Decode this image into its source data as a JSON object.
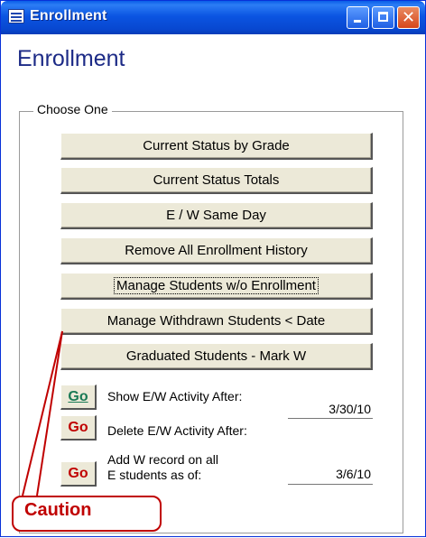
{
  "window": {
    "title": "Enrollment"
  },
  "form": {
    "heading": "Enrollment",
    "group_label": "Choose One"
  },
  "buttons": [
    "Current Status by Grade",
    "Current Status Totals",
    "E / W Same Day",
    "Remove All Enrollment History",
    "Manage Students w/o Enrollment",
    "Manage Withdrawn Students < Date",
    "Graduated Students - Mark W"
  ],
  "actions": [
    {
      "go_label": "Go",
      "label": "Show E/W Activity After:",
      "value": "3/30/10"
    },
    {
      "go_label": "Go",
      "label": "Delete E/W Activity After:",
      "value": ""
    },
    {
      "go_label": "Go",
      "label_line1": "Add W record on all",
      "label_line2": "E students as of:",
      "value": "3/6/10"
    }
  ],
  "callout": {
    "text": "Caution",
    "color": "#c00000"
  },
  "colors": {
    "title_bar": "#0b55e2",
    "heading": "#1c2a86",
    "button_face": "#ece9d8"
  }
}
